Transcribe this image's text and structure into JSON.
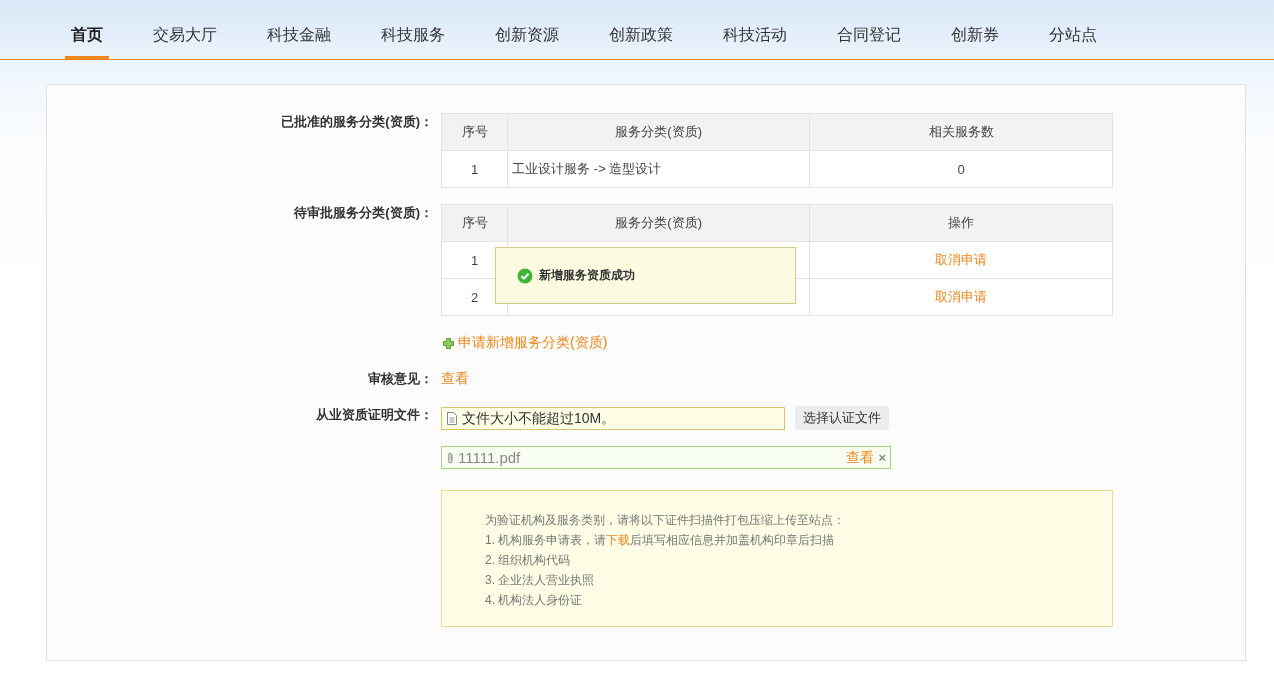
{
  "nav": [
    {
      "label": "首页",
      "selected": true
    },
    {
      "label": "交易大厅",
      "selected": false
    },
    {
      "label": "科技金融",
      "selected": false
    },
    {
      "label": "科技服务",
      "selected": false
    },
    {
      "label": "创新资源",
      "selected": false
    },
    {
      "label": "创新政策",
      "selected": false
    },
    {
      "label": "科技活动",
      "selected": false
    },
    {
      "label": "合同登记",
      "selected": false
    },
    {
      "label": "创新券",
      "selected": false
    },
    {
      "label": "分站点",
      "selected": false
    }
  ],
  "approved": {
    "label": "已批准的服务分类(资质)：",
    "columns": [
      "序号",
      "服务分类(资质)",
      "相关服务数"
    ],
    "rows": [
      {
        "no": "1",
        "category": "工业设计服务 -> 造型设计",
        "count": "0"
      }
    ]
  },
  "pending": {
    "label": "待审批服务分类(资质)：",
    "columns": [
      "序号",
      "服务分类(资质)",
      "操作"
    ],
    "rows": [
      {
        "no": "1",
        "action": "取消申请"
      },
      {
        "no": "2",
        "action": "取消申请"
      }
    ]
  },
  "toast": {
    "kind": "success",
    "message": "新增服务资质成功"
  },
  "add_link": "申请新增服务分类(资质)",
  "review": {
    "label": "审核意见：",
    "link": "查看"
  },
  "file": {
    "label": "从业资质证明文件：",
    "placeholder": "文件大小不能超过10M。",
    "button": "选择认证文件"
  },
  "uploaded": {
    "name": "11111.pdf",
    "view": "查看",
    "remove": "×"
  },
  "notice": {
    "intro": "为验证机构及服务类别，请将以下证件扫描件打包压缩上传至站点：",
    "items": [
      {
        "before": "1. 机构服务申请表，请",
        "link": "下载",
        "after": "后填写相应信息并加盖机构印章后扫描"
      },
      {
        "before": "2. 组织机构代码"
      },
      {
        "before": "3. 企业法人营业执照"
      },
      {
        "before": "4. 机构法人身份证"
      }
    ]
  }
}
